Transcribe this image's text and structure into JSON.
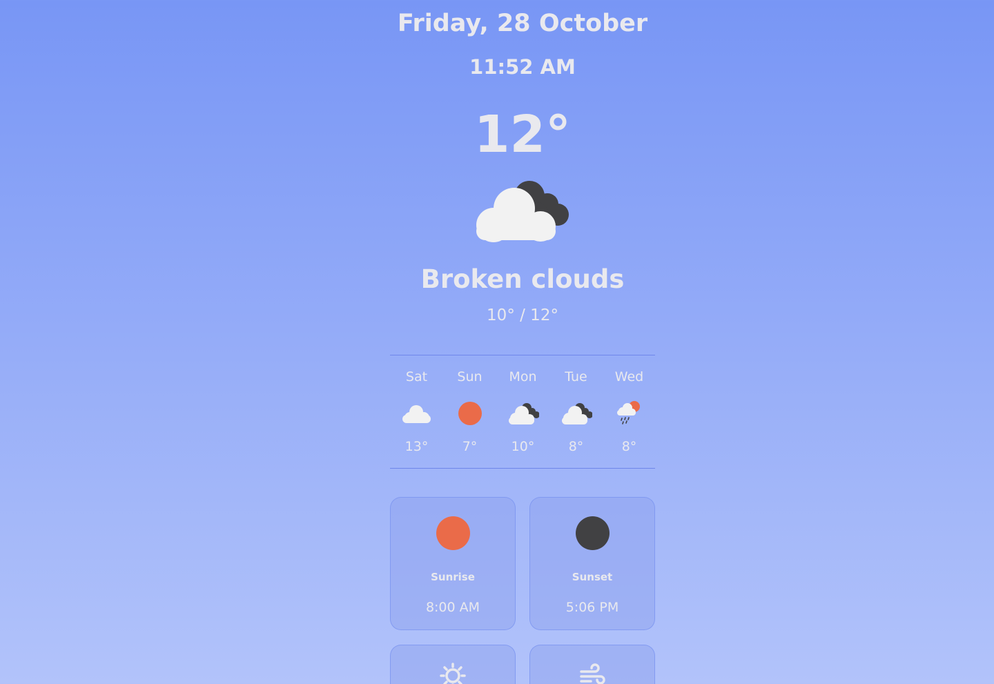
{
  "header": {
    "date": "Friday, 28 October",
    "time": "11:52 AM"
  },
  "current": {
    "temperature": "12°",
    "icon": "broken-clouds-icon",
    "description": "Broken clouds",
    "range": "10° / 12°"
  },
  "forecast": [
    {
      "day": "Sat",
      "icon": "cloud-icon",
      "temp": "13°"
    },
    {
      "day": "Sun",
      "icon": "sun-icon",
      "temp": "7°"
    },
    {
      "day": "Mon",
      "icon": "broken-clouds-icon",
      "temp": "10°"
    },
    {
      "day": "Tue",
      "icon": "broken-clouds-icon",
      "temp": "8°"
    },
    {
      "day": "Wed",
      "icon": "rain-sun-icon",
      "temp": "8°"
    }
  ],
  "details": {
    "sunrise": {
      "label": "Sunrise",
      "value": "8:00 AM",
      "icon": "sunrise-icon"
    },
    "sunset": {
      "label": "Sunset",
      "value": "5:06 PM",
      "icon": "sunset-icon"
    },
    "uv": {
      "icon": "sun-outline-icon"
    },
    "wind": {
      "icon": "wind-icon"
    }
  },
  "colors": {
    "sun": "#ea6b49",
    "dark_cloud": "#414143",
    "light_cloud": "#f2f2f2",
    "text": "#e9e9ee"
  }
}
